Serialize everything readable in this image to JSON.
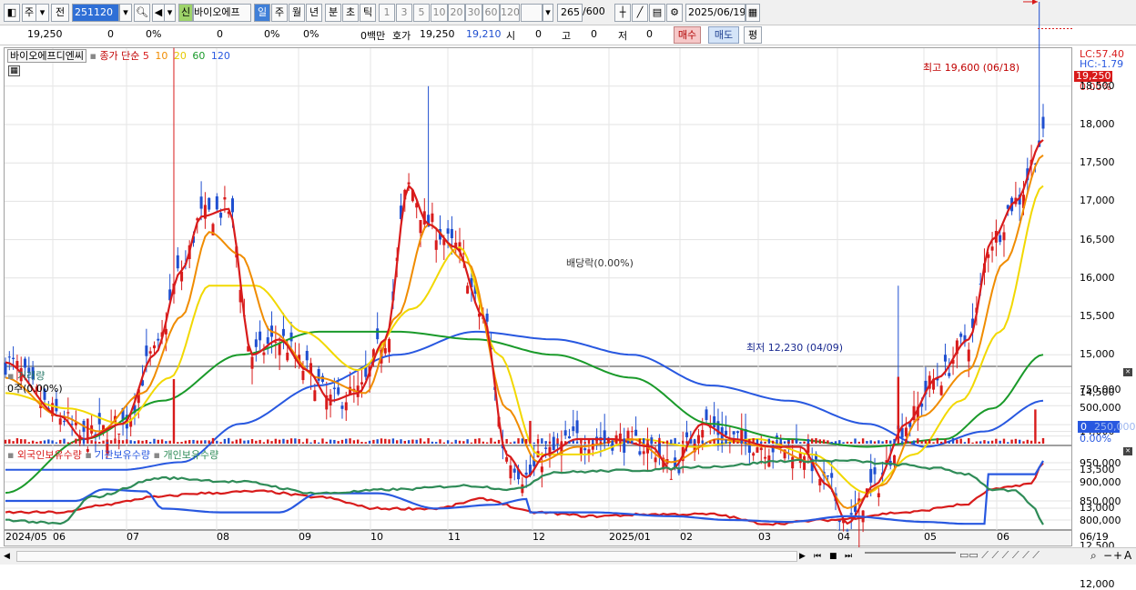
{
  "toolbar": {
    "mode_label": "주",
    "prev_label": "전",
    "code_value": "251120",
    "sin_badge": "신",
    "stock_name": "바이오에프",
    "periods": [
      "일",
      "주",
      "월",
      "년",
      "분",
      "초",
      "틱"
    ],
    "active_period": "일",
    "intervals": [
      "1",
      "3",
      "5",
      "10",
      "20",
      "30",
      "60",
      "120"
    ],
    "count_value": "265",
    "count_max": "/600",
    "date_value": "2025/06/19"
  },
  "infobar": {
    "price": "19,250",
    "change": "0",
    "change_pct": "0%",
    "volume": "0",
    "vol_pct": "0%",
    "vol_pct2": "0%",
    "amount": "0백만",
    "quote_label": "호가",
    "bid_ask_1": "19,250",
    "bid_ask_2": "19,210",
    "open_label": "시",
    "open_val": "0",
    "high_label": "고",
    "high_val": "0",
    "low_label": "저",
    "low_val": "0",
    "buy_label": "매수",
    "sell_label": "매도",
    "avg_label": "평"
  },
  "price_legend": {
    "name": "바이오에프디엔씨",
    "ma_label": "종가 단순",
    "periods": [
      "5",
      "10",
      "20",
      "60",
      "120"
    ]
  },
  "price_axis": {
    "lc": "LC:57.40",
    "hc": "HC:-1.79",
    "current": "19,250",
    "pct": "0.00%",
    "ticks": [
      "18,500",
      "18,000",
      "17,500",
      "17,000",
      "16,500",
      "16,000",
      "15,500",
      "15,000",
      "14,500",
      "14,000",
      "13,500",
      "13,000",
      "12,500",
      "12,000"
    ]
  },
  "annotations": {
    "high": "최고 19,600 (06/18)",
    "low": "최저 12,230 (04/09)",
    "dividend": "배당락(0.00%)"
  },
  "volume_pane": {
    "title": "거래량",
    "sub": "0주(0.00%)",
    "ticks": [
      "750,000",
      "500,000",
      "250,000"
    ],
    "current": "0",
    "pct": "0.00%"
  },
  "holding_pane": {
    "legend": [
      "외국인보유수량",
      "기관보유수량",
      "개인보유수량"
    ],
    "ticks": [
      "950,000",
      "900,000",
      "850,000",
      "800,000"
    ]
  },
  "x_axis": [
    "2024/05",
    "06",
    "07",
    "08",
    "09",
    "10",
    "11",
    "12",
    "2025/01",
    "02",
    "03",
    "04",
    "05",
    "06",
    "06/19"
  ],
  "colors": {
    "ma5": "#d81b1b",
    "ma10": "#f08c00",
    "ma20": "#f2e21a",
    "ma60": "#1a9a2a",
    "ma120": "#2858e0",
    "up": "#d81b1b",
    "down": "#1f4fd0",
    "foreign": "#d81b1b",
    "institution": "#2858e0",
    "individual": "#2e8b57"
  },
  "chart_data": [
    {
      "type": "candlestick",
      "title": "바이오에프디엔씨",
      "x_range": [
        "2024/05",
        "2025/06/19"
      ],
      "ylim": [
        12000,
        19600
      ],
      "series": [
        {
          "name": "5",
          "anchors": [
            [
              0,
              14900
            ],
            [
              14,
              14200
            ],
            [
              20,
              13900
            ],
            [
              30,
              14100
            ],
            [
              38,
              15000
            ],
            [
              45,
              16100
            ],
            [
              50,
              16800
            ],
            [
              57,
              16900
            ],
            [
              63,
              15000
            ],
            [
              70,
              15200
            ],
            [
              77,
              14800
            ],
            [
              83,
              14400
            ],
            [
              90,
              14500
            ],
            [
              97,
              15200
            ],
            [
              103,
              17200
            ],
            [
              108,
              16700
            ],
            [
              115,
              16400
            ],
            [
              122,
              15500
            ],
            [
              128,
              13700
            ],
            [
              133,
              13400
            ],
            [
              138,
              13700
            ],
            [
              146,
              13900
            ],
            [
              155,
              13900
            ],
            [
              165,
              13800
            ],
            [
              170,
              13500
            ],
            [
              178,
              14100
            ],
            [
              186,
              13900
            ],
            [
              196,
              13800
            ],
            [
              203,
              13800
            ],
            [
              210,
              13300
            ],
            [
              215,
              12800
            ],
            [
              222,
              13300
            ],
            [
              230,
              14100
            ],
            [
              238,
              14700
            ],
            [
              246,
              15200
            ],
            [
              252,
              16500
            ],
            [
              258,
              17000
            ],
            [
              265,
              17800
            ]
          ]
        },
        {
          "name": "10",
          "anchors": [
            [
              0,
              14700
            ],
            [
              14,
              14200
            ],
            [
              24,
              14000
            ],
            [
              35,
              14500
            ],
            [
              45,
              15500
            ],
            [
              52,
              16600
            ],
            [
              60,
              16300
            ],
            [
              68,
              15300
            ],
            [
              80,
              14700
            ],
            [
              92,
              14500
            ],
            [
              100,
              15500
            ],
            [
              108,
              16700
            ],
            [
              118,
              16200
            ],
            [
              128,
              14300
            ],
            [
              136,
              13600
            ],
            [
              146,
              13800
            ],
            [
              160,
              13900
            ],
            [
              170,
              13600
            ],
            [
              182,
              13900
            ],
            [
              195,
              13800
            ],
            [
              206,
              13600
            ],
            [
              215,
              13000
            ],
            [
              224,
              13300
            ],
            [
              234,
              14200
            ],
            [
              246,
              14800
            ],
            [
              255,
              16200
            ],
            [
              265,
              17600
            ]
          ]
        },
        {
          "name": "20",
          "anchors": [
            [
              0,
              14500
            ],
            [
              16,
              14300
            ],
            [
              30,
              14100
            ],
            [
              42,
              14700
            ],
            [
              52,
              15900
            ],
            [
              64,
              15900
            ],
            [
              76,
              15300
            ],
            [
              90,
              14800
            ],
            [
              104,
              15600
            ],
            [
              116,
              16400
            ],
            [
              126,
              15000
            ],
            [
              136,
              13700
            ],
            [
              148,
              13700
            ],
            [
              162,
              13900
            ],
            [
              176,
              13800
            ],
            [
              192,
              13900
            ],
            [
              206,
              13700
            ],
            [
              220,
              13200
            ],
            [
              232,
              13700
            ],
            [
              244,
              14400
            ],
            [
              254,
              15300
            ],
            [
              265,
              17200
            ]
          ]
        },
        {
          "name": "60",
          "anchors": [
            [
              0,
              13200
            ],
            [
              20,
              13900
            ],
            [
              40,
              14400
            ],
            [
              60,
              15000
            ],
            [
              80,
              15300
            ],
            [
              100,
              15300
            ],
            [
              120,
              15200
            ],
            [
              140,
              15000
            ],
            [
              160,
              14700
            ],
            [
              180,
              14100
            ],
            [
              200,
              13900
            ],
            [
              220,
              13800
            ],
            [
              240,
              13900
            ],
            [
              252,
              14300
            ],
            [
              265,
              15000
            ]
          ]
        },
        {
          "name": "120",
          "anchors": [
            [
              0,
              13500
            ],
            [
              30,
              13500
            ],
            [
              45,
              13600
            ],
            [
              60,
              14100
            ],
            [
              80,
              14600
            ],
            [
              100,
              15000
            ],
            [
              120,
              15300
            ],
            [
              140,
              15200
            ],
            [
              160,
              15000
            ],
            [
              180,
              14600
            ],
            [
              200,
              14400
            ],
            [
              220,
              14100
            ],
            [
              235,
              13800
            ],
            [
              250,
              14000
            ],
            [
              265,
              14400
            ]
          ]
        }
      ]
    },
    {
      "type": "bar",
      "title": "거래량",
      "ylim": [
        0,
        1000000
      ],
      "series": [
        {
          "name": "거래량",
          "spikes": [
            [
              21,
              330000
            ],
            [
              43,
              850000
            ],
            [
              134,
              300000
            ],
            [
              228,
              880000
            ],
            [
              263,
              450000
            ]
          ]
        }
      ]
    },
    {
      "type": "line",
      "title": "보유수량",
      "ylim": [
        770000,
        980000
      ],
      "series": [
        {
          "name": "외국인보유수량",
          "anchors": [
            [
              0,
              820000
            ],
            [
              15,
              820000
            ],
            [
              25,
              840000
            ],
            [
              38,
              860000
            ],
            [
              50,
              870000
            ],
            [
              65,
              875000
            ],
            [
              80,
              860000
            ],
            [
              95,
              830000
            ],
            [
              110,
              830000
            ],
            [
              122,
              855000
            ],
            [
              135,
              820000
            ],
            [
              150,
              810000
            ],
            [
              165,
              815000
            ],
            [
              180,
              815000
            ],
            [
              195,
              790000
            ],
            [
              210,
              800000
            ],
            [
              230,
              820000
            ],
            [
              245,
              840000
            ],
            [
              252,
              880000
            ],
            [
              262,
              895000
            ],
            [
              265,
              950000
            ]
          ]
        },
        {
          "name": "기관보유수량",
          "anchors": [
            [
              0,
              850000
            ],
            [
              18,
              850000
            ],
            [
              25,
              880000
            ],
            [
              36,
              875000
            ],
            [
              40,
              830000
            ],
            [
              55,
              820000
            ],
            [
              70,
              820000
            ],
            [
              80,
              870000
            ],
            [
              95,
              870000
            ],
            [
              110,
              830000
            ],
            [
              125,
              840000
            ],
            [
              133,
              855000
            ],
            [
              134,
              820000
            ],
            [
              150,
              820000
            ],
            [
              170,
              810000
            ],
            [
              185,
              800000
            ],
            [
              200,
              795000
            ],
            [
              215,
              810000
            ],
            [
              235,
              795000
            ],
            [
              245,
              790000
            ],
            [
              250,
              790000
            ],
            [
              251,
              920000
            ],
            [
              258,
              920000
            ],
            [
              263,
              920000
            ],
            [
              265,
              955000
            ]
          ]
        },
        {
          "name": "개인보유수량",
          "anchors": [
            [
              0,
              800000
            ],
            [
              14,
              790000
            ],
            [
              22,
              860000
            ],
            [
              40,
              910000
            ],
            [
              60,
              900000
            ],
            [
              80,
              870000
            ],
            [
              100,
              880000
            ],
            [
              118,
              890000
            ],
            [
              130,
              880000
            ],
            [
              140,
              925000
            ],
            [
              160,
              930000
            ],
            [
              180,
              940000
            ],
            [
              200,
              955000
            ],
            [
              215,
              955000
            ],
            [
              228,
              945000
            ],
            [
              238,
              935000
            ],
            [
              246,
              920000
            ],
            [
              252,
              880000
            ],
            [
              258,
              875000
            ],
            [
              262,
              840000
            ],
            [
              265,
              790000
            ]
          ]
        }
      ]
    }
  ]
}
